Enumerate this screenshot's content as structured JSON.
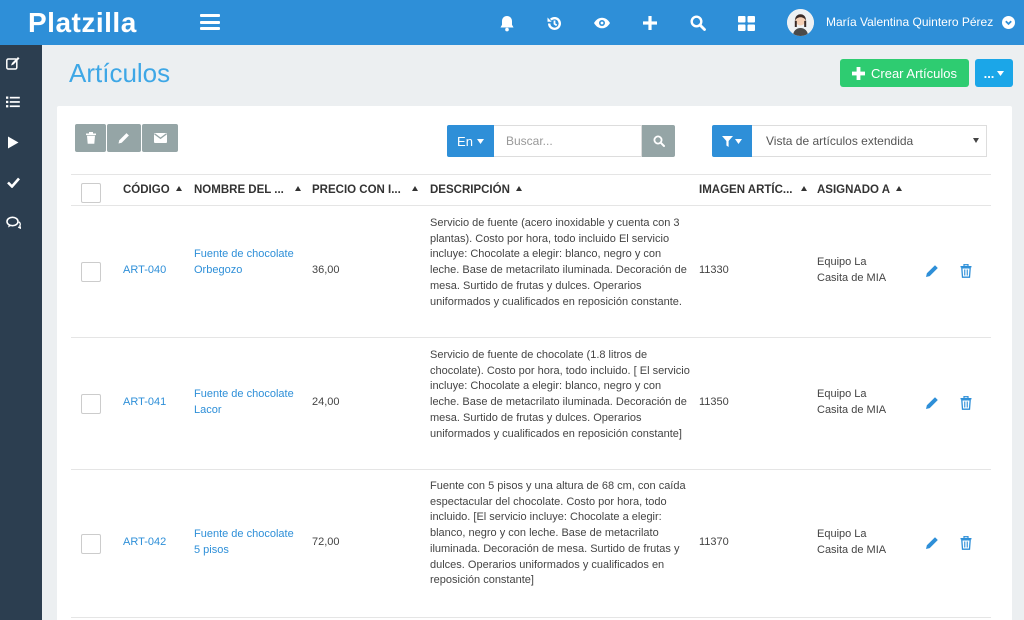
{
  "app": {
    "logo": "Platzilla"
  },
  "topbar": {
    "icons": [
      "bell-icon",
      "history-icon",
      "eye-icon",
      "plus-icon",
      "search-icon",
      "grid-icon"
    ],
    "user_name": "María Valentina Quintero Pérez"
  },
  "sidebar": {
    "items": [
      "edit-icon",
      "list-icon",
      "play-icon",
      "check-icon",
      "chat-icon"
    ]
  },
  "page": {
    "title": "Artículos",
    "create_label": "Crear Artículos",
    "more_label": "..."
  },
  "toolbar": {
    "lang_label": "En",
    "search_placeholder": "Buscar...",
    "view_label": "Vista de artículos extendida"
  },
  "table": {
    "headers": {
      "code": "CÓDIGO",
      "name": "NOMBRE DEL ...",
      "price": "PRECIO CON I...",
      "description": "DESCRIPCIÓN",
      "image": "IMAGEN ARTÍC...",
      "assigned": "ASIGNADO A"
    },
    "rows": [
      {
        "code": "ART-040",
        "name": "Fuente de chocolate Orbegozo",
        "price": "36,00",
        "description": "Servicio de fuente (acero inoxidable y cuenta con 3 plantas). Costo por hora, todo incluido El servicio incluye: Chocolate a elegir: blanco, negro y con leche. Base de metacrilato iluminada. Decoración de mesa. Surtido de frutas y dulces. Operarios uniformados y cualificados en reposición constante.",
        "image": "11330",
        "assigned": "Equipo La Casita de MIA"
      },
      {
        "code": "ART-041",
        "name": "Fuente de chocolate Lacor",
        "price": "24,00",
        "description": "Servicio de fuente de chocolate (1.8 litros de chocolate). Costo por hora, todo incluido. [ El servicio incluye: Chocolate a elegir: blanco, negro y con leche. Base de metacrilato iluminada. Decoración de mesa. Surtido de frutas y dulces. Operarios uniformados y cualificados en reposición constante]",
        "image": "11350",
        "assigned": "Equipo La Casita de MIA"
      },
      {
        "code": "ART-042",
        "name": "Fuente de chocolate 5 pisos",
        "price": "72,00",
        "description": "Fuente con 5 pisos y una altura de 68 cm, con caída espectacular del chocolate. Costo por hora, todo incluido. [El servicio incluye: Chocolate a elegir: blanco, negro y con leche. Base de metacrilato iluminada. Decoración de mesa. Surtido de frutas y dulces. Operarios uniformados y cualificados en reposición constante]",
        "image": "11370",
        "assigned": "Equipo La Casita de MIA"
      }
    ]
  },
  "colors": {
    "primary": "#2e8fd8",
    "success": "#2ecc71",
    "sidebar": "#2c3e50",
    "gray_button": "#95a5a6",
    "title": "#3ea7e6"
  }
}
